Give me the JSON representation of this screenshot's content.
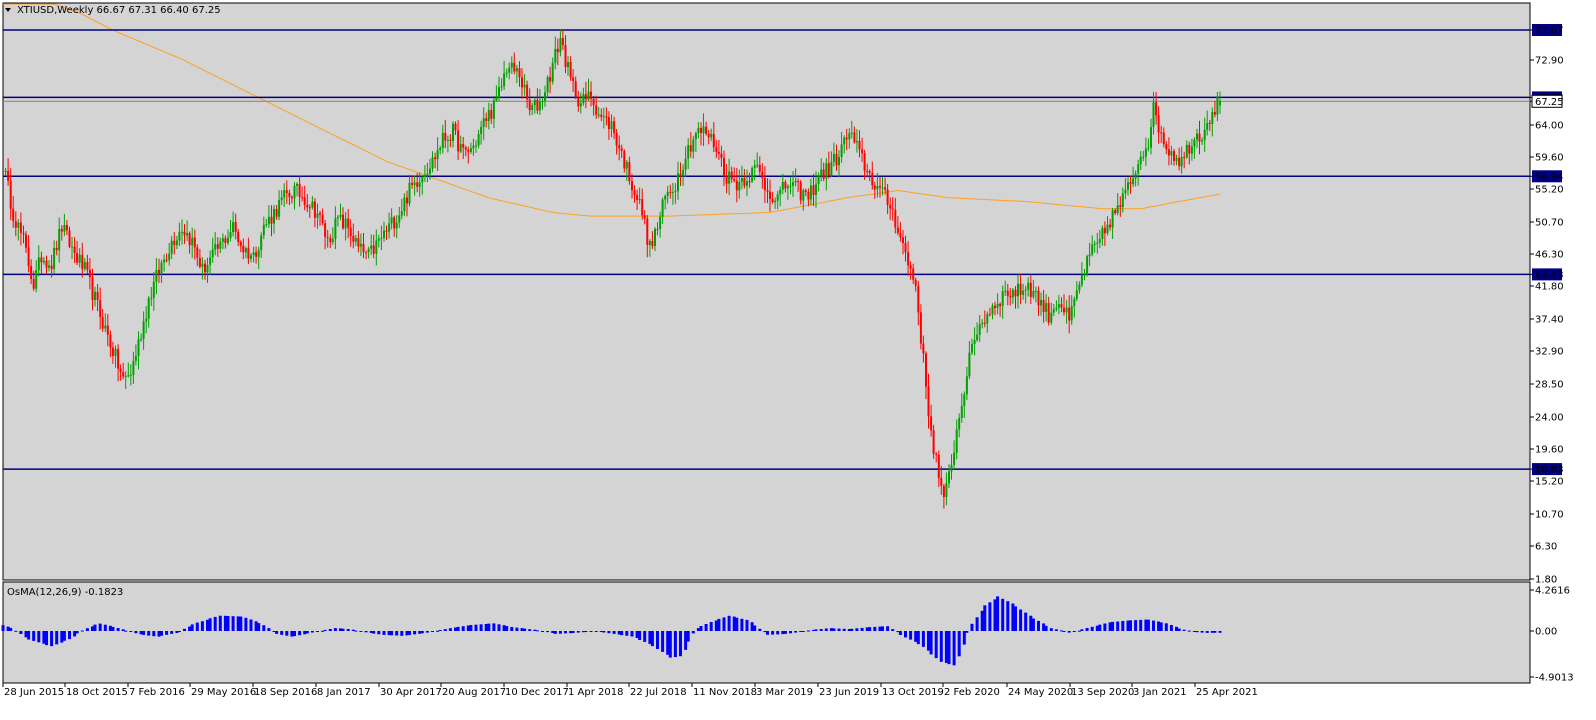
{
  "header": {
    "symbol_info": "XTIUSD,Weekly  66.67 67.31 66.40 67.25",
    "indicator_info": "OsMA(12,26,9) -0.1823"
  },
  "colors": {
    "background": "#d4d4d4",
    "bull": "#00a000",
    "bear": "#ff0000",
    "ma": "#ffa020",
    "hline": "#000080",
    "osma": "#0000ff",
    "hline_label_bg": "#000080"
  },
  "chart_data": [
    {
      "type": "candlestick",
      "title": "XTIUSD,Weekly",
      "ohlc_last": {
        "open": 66.67,
        "high": 67.31,
        "low": 66.4,
        "close": 67.25
      },
      "ylim": [
        1.8,
        80.0
      ],
      "y_ticks": [
        77.07,
        72.9,
        67.78,
        67.25,
        64.0,
        59.6,
        56.94,
        55.2,
        50.7,
        46.3,
        43.43,
        41.8,
        37.4,
        32.9,
        28.5,
        24.0,
        19.6,
        16.83,
        15.2,
        10.7,
        6.3,
        1.8
      ],
      "x_labels": [
        "28 Jun 2015",
        "18 Oct 2015",
        "7 Feb 2016",
        "29 May 2016",
        "18 Sep 2016",
        "8 Jan 2017",
        "30 Apr 2017",
        "20 Aug 2017",
        "10 Dec 2017",
        "1 Apr 2018",
        "22 Jul 2018",
        "11 Nov 2018",
        "3 Mar 2019",
        "23 Jun 2019",
        "13 Oct 2019",
        "2 Feb 2020",
        "24 May 2020",
        "13 Sep 2020",
        "3 Jan 2021",
        "25 Apr 2021"
      ],
      "horizontal_levels": [
        77.07,
        67.78,
        56.94,
        43.43,
        16.83
      ],
      "current_price": 67.25,
      "close_path": [
        [
          0,
          58.5
        ],
        [
          4,
          52
        ],
        [
          8,
          48
        ],
        [
          12,
          42
        ],
        [
          15,
          46
        ],
        [
          19,
          45
        ],
        [
          23,
          50
        ],
        [
          27,
          47
        ],
        [
          32,
          44
        ],
        [
          36,
          40
        ],
        [
          40,
          36
        ],
        [
          44,
          32
        ],
        [
          47,
          29
        ],
        [
          50,
          30
        ],
        [
          53,
          34
        ],
        [
          57,
          40
        ],
        [
          61,
          44
        ],
        [
          66,
          48
        ],
        [
          70,
          50
        ],
        [
          74,
          48
        ],
        [
          78,
          44
        ],
        [
          82,
          46
        ],
        [
          86,
          48
        ],
        [
          90,
          50
        ],
        [
          94,
          47
        ],
        [
          98,
          46
        ],
        [
          102,
          50
        ],
        [
          106,
          52
        ],
        [
          110,
          54
        ],
        [
          114,
          55
        ],
        [
          118,
          54
        ],
        [
          123,
          52
        ],
        [
          127,
          48
        ],
        [
          131,
          51
        ],
        [
          135,
          50
        ],
        [
          139,
          47
        ],
        [
          143,
          46
        ],
        [
          147,
          48
        ],
        [
          151,
          50
        ],
        [
          155,
          52
        ],
        [
          159,
          55
        ],
        [
          163,
          57
        ],
        [
          168,
          59
        ],
        [
          172,
          62
        ],
        [
          176,
          63
        ],
        [
          180,
          60
        ],
        [
          184,
          61
        ],
        [
          189,
          65
        ],
        [
          193,
          67
        ],
        [
          197,
          72
        ],
        [
          202,
          71
        ],
        [
          206,
          66
        ],
        [
          210,
          67
        ],
        [
          214,
          71
        ],
        [
          218,
          76
        ],
        [
          222,
          70
        ],
        [
          226,
          67
        ],
        [
          230,
          68
        ],
        [
          234,
          65
        ],
        [
          238,
          64
        ],
        [
          242,
          60
        ],
        [
          246,
          56
        ],
        [
          250,
          52
        ],
        [
          253,
          47
        ],
        [
          256,
          50
        ],
        [
          259,
          54
        ],
        [
          263,
          56
        ],
        [
          267,
          60
        ],
        [
          271,
          63
        ],
        [
          275,
          63
        ],
        [
          279,
          61
        ],
        [
          283,
          57
        ],
        [
          287,
          56
        ],
        [
          291,
          57
        ],
        [
          295,
          58
        ],
        [
          299,
          55
        ],
        [
          303,
          54
        ],
        [
          307,
          56
        ],
        [
          311,
          55
        ],
        [
          315,
          54
        ],
        [
          319,
          57
        ],
        [
          323,
          58
        ],
        [
          327,
          60
        ],
        [
          331,
          63
        ],
        [
          335,
          60
        ],
        [
          339,
          57
        ],
        [
          343,
          55
        ],
        [
          347,
          53
        ],
        [
          350,
          50
        ],
        [
          354,
          45
        ],
        [
          357,
          42
        ],
        [
          359,
          35
        ],
        [
          361,
          28
        ],
        [
          363,
          22
        ],
        [
          365,
          18
        ],
        [
          368,
          12
        ],
        [
          371,
          18
        ],
        [
          374,
          24
        ],
        [
          377,
          30
        ],
        [
          381,
          36
        ],
        [
          385,
          38
        ],
        [
          389,
          40
        ],
        [
          393,
          41
        ],
        [
          397,
          41
        ],
        [
          401,
          42
        ],
        [
          405,
          40
        ],
        [
          409,
          38
        ],
        [
          413,
          40
        ],
        [
          417,
          37
        ],
        [
          421,
          42
        ],
        [
          425,
          46
        ],
        [
          429,
          48
        ],
        [
          433,
          51
        ],
        [
          437,
          53
        ],
        [
          441,
          56
        ],
        [
          445,
          60
        ],
        [
          448,
          62
        ],
        [
          450,
          66
        ],
        [
          452,
          64
        ],
        [
          455,
          61
        ],
        [
          458,
          60
        ],
        [
          461,
          59
        ],
        [
          465,
          62
        ],
        [
          469,
          63
        ],
        [
          473,
          66
        ],
        [
          476,
          67.25
        ]
      ],
      "ma_path": [
        [
          0,
          82
        ],
        [
          30,
          79
        ],
        [
          70,
          73
        ],
        [
          110,
          66
        ],
        [
          150,
          59
        ],
        [
          190,
          54
        ],
        [
          215,
          52
        ],
        [
          230,
          51.5
        ],
        [
          260,
          51.5
        ],
        [
          300,
          52
        ],
        [
          330,
          54
        ],
        [
          350,
          55
        ],
        [
          370,
          54
        ],
        [
          400,
          53.5
        ],
        [
          430,
          52.5
        ],
        [
          445,
          52.5
        ],
        [
          460,
          53.5
        ],
        [
          476,
          54.5
        ]
      ]
    },
    {
      "type": "histogram",
      "title": "OsMA(12,26,9)",
      "current_value": -0.1823,
      "ylim": [
        -4.9013,
        4.2616
      ],
      "y_ticks": [
        4.2616,
        0.0,
        -4.9013
      ]
    }
  ]
}
